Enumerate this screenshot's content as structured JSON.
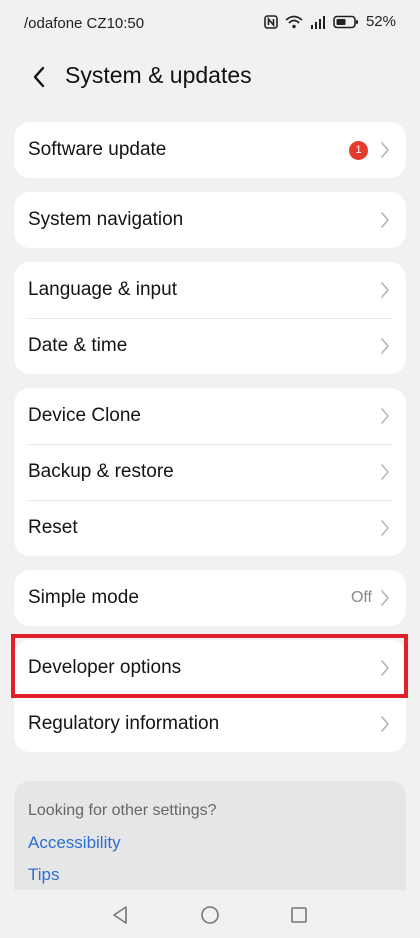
{
  "status": {
    "carrier": "/odafone CZ",
    "time": "10:50",
    "battery": "52%",
    "icons": [
      "nfc-icon",
      "wifi-icon",
      "signal-icon",
      "battery-icon"
    ]
  },
  "header": {
    "title": "System & updates",
    "back_icon": "back-arrow-icon"
  },
  "groups": [
    {
      "items": [
        {
          "label": "Software update",
          "badge": "1"
        }
      ]
    },
    {
      "items": [
        {
          "label": "System navigation"
        }
      ]
    },
    {
      "items": [
        {
          "label": "Language & input"
        },
        {
          "label": "Date & time"
        }
      ]
    },
    {
      "items": [
        {
          "label": "Device Clone"
        },
        {
          "label": "Backup & restore"
        },
        {
          "label": "Reset"
        }
      ]
    },
    {
      "items": [
        {
          "label": "Simple mode",
          "value": "Off"
        }
      ]
    },
    {
      "items": [
        {
          "label": "Developer options",
          "highlighted": true
        },
        {
          "label": "Regulatory information"
        }
      ]
    }
  ],
  "suggestions": {
    "heading": "Looking for other settings?",
    "links": [
      "Accessibility",
      "Tips"
    ]
  },
  "navbar": {
    "buttons": [
      "back-triangle-icon",
      "home-circle-icon",
      "recents-square-icon"
    ]
  },
  "colors": {
    "background": "#f1f1f1",
    "card": "#ffffff",
    "badge": "#e63a2e",
    "highlight": "#e0202a",
    "link": "#2a6fd1"
  }
}
